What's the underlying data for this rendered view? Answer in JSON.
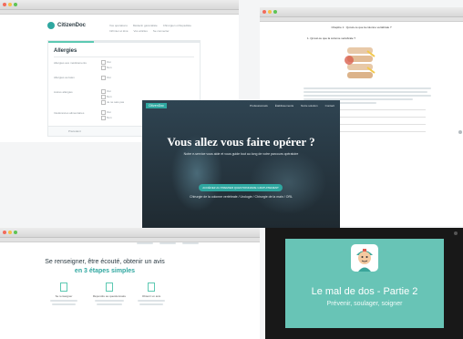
{
  "form_screen": {
    "brand": "CitizenDoc",
    "nav": [
      "Vos opérations",
      "Médecin généraliste",
      "Chirurgien orthopédiste",
      "Infirmier et kiné",
      "Vos articles",
      "Se connecter"
    ],
    "heading": "Allergies",
    "fields": [
      {
        "label": "Allergies aux médicaments",
        "options": [
          "Oui",
          "Non"
        ]
      },
      {
        "label": "Allergies au latex",
        "options": [
          "Oui",
          "Non"
        ]
      },
      {
        "label": "Autres allergies",
        "options": [
          "Oui",
          "Non",
          "Je ne sais pas"
        ]
      },
      {
        "label": "Intolérances alimentaires",
        "options": [
          "Oui",
          "Non"
        ]
      }
    ],
    "footer": [
      "Précédent",
      "Suivant"
    ]
  },
  "article_screen": {
    "title": "Chapitre 1 : Qu'est-ce que la colonne vertébrale ?",
    "section": "1. Qu'est-ce que la colonne vertébrale ?"
  },
  "hero": {
    "brand": "CitizenDoc",
    "nav": [
      "Professionnels",
      "Établissements",
      "Notre solution",
      "Contact"
    ],
    "title": "Vous allez vous faire opérer ?",
    "subtitle": "Notre e-service vous aide et vous guide tout au long de votre parcours opératoire",
    "cta": "ACCÉDEZ AU PREMIER QUESTIONNAIRE GRATUITEMENT",
    "specialties": "Chirurgie de la colonne vertébrale / Urologie / Chirurgie de la main / ORL"
  },
  "steps_screen": {
    "headline": "Se renseigner, être écouté, obtenir un avis",
    "headline_accent": "en 3 étapes simples",
    "steps": [
      "Se renseigner",
      "Répondre au questionnaire",
      "Obtenir un avis"
    ]
  },
  "video": {
    "title": "Le mal de dos - Partie 2",
    "subtitle": "Prévenir, soulager, soigner"
  },
  "colors": {
    "teal": "#2fa7a0",
    "mint": "#5cc9b2",
    "video_bg": "#68c4b6",
    "blue_tab": "#2ea8e6"
  }
}
